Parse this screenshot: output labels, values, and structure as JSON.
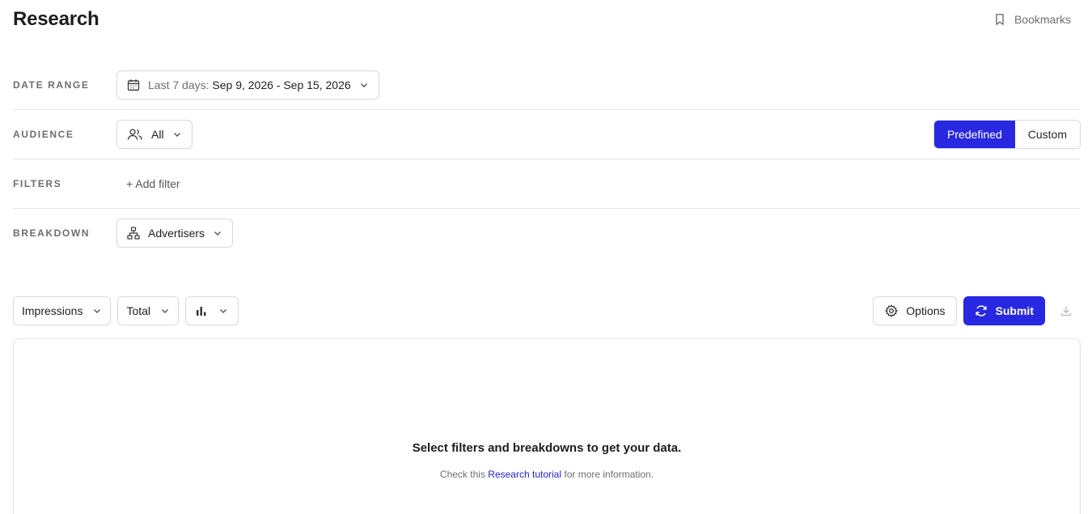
{
  "header": {
    "title": "Research",
    "bookmarks_label": "Bookmarks"
  },
  "date_range": {
    "label": "DATE RANGE",
    "prefix": "Last 7 days:",
    "value": "Sep 9, 2026 - Sep 15, 2026"
  },
  "audience": {
    "label": "AUDIENCE",
    "value": "All",
    "toggle": {
      "predefined": "Predefined",
      "custom": "Custom",
      "selected": "Predefined"
    }
  },
  "filters": {
    "label": "FILTERS",
    "add_label": "+ Add filter"
  },
  "breakdown": {
    "label": "BREAKDOWN",
    "value": "Advertisers"
  },
  "toolbar": {
    "metric": "Impressions",
    "aggregation": "Total",
    "chart_icon": "bar-chart-icon",
    "options_label": "Options",
    "submit_label": "Submit"
  },
  "empty_state": {
    "title": "Select filters and breakdowns to get your data.",
    "sub_before": "Check this",
    "sub_link": "Research tutorial",
    "sub_after": "for more information."
  },
  "colors": {
    "accent": "#2828e0",
    "link": "#2323c8",
    "border": "#d9d9de"
  }
}
